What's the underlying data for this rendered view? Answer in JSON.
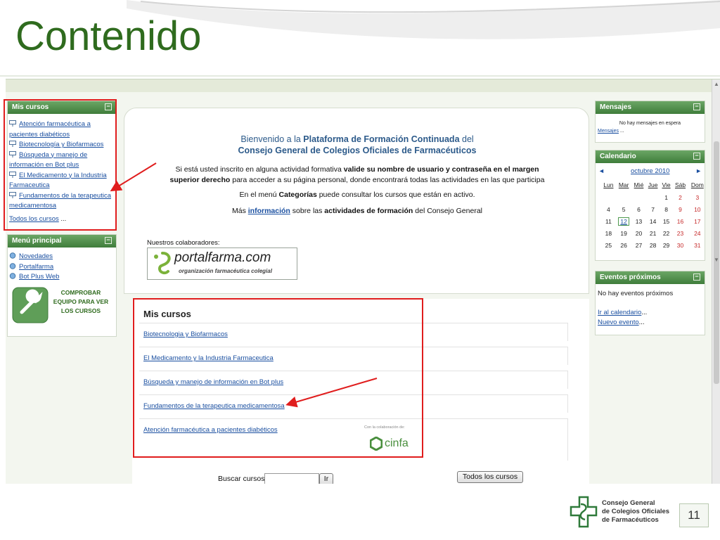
{
  "slide": {
    "title": "Contenido",
    "page_number": "11",
    "footer_logo": {
      "line1": "Consejo General",
      "line2": "de Colegios Oficiales",
      "line3": "de Farmacéuticos"
    }
  },
  "colors": {
    "brand_green": "#2f6b1e",
    "block_header": "#4f8f4a",
    "link_blue": "#1a4fa0",
    "highlight_red": "#e01d1d"
  },
  "left": {
    "mis_cursos": {
      "title": "Mis cursos",
      "courses": [
        {
          "label_1": "Atención farmacéutica a",
          "label_2": "pacientes diabéticos"
        },
        {
          "label_1": "Biotecnología y Biofarmacos",
          "label_2": ""
        },
        {
          "label_1": "Búsqueda y manejo de",
          "label_2": "información en Bot plus"
        },
        {
          "label_1": "El Medicamento y la Industria",
          "label_2": "Farmaceutica"
        },
        {
          "label_1": "Fundamentos de la terapeutica",
          "label_2": "medicamentosa"
        }
      ],
      "all_courses": "Todos los cursos",
      "all_courses_suffix": "..."
    },
    "menu_principal": {
      "title": "Menú principal",
      "items": [
        "Novedades",
        "Portalfarma",
        "Bot Plus Web"
      ],
      "check_button": {
        "line1": "COMPROBAR",
        "line2": "EQUIPO PARA VER",
        "line3": "LOS CURSOS"
      }
    }
  },
  "center": {
    "welcome_line1_pre": "Bienvenido a la ",
    "welcome_line1_bold": "Plataforma de Formación Continuada",
    "welcome_line1_post": " del",
    "welcome_line2": "Consejo General de Colegios Oficiales de Farmacéuticos",
    "para1_pre": "Si está usted inscrito en alguna actividad formativa ",
    "para1_bold1": "valide su nombre de usuario y contraseña en el margen",
    "para1_bold2": "superior derecho",
    "para1_post": " para acceder a su página personal, donde encontrará todas las actividades en las que participa",
    "para2_pre": "En el menú ",
    "para2_bold": "Categorías",
    "para2_post": " puede consultar los cursos que están en activo.",
    "para3_pre": "Más ",
    "para3_link": "información",
    "para3_mid": " sobre las ",
    "para3_bold": "actividades de formación",
    "para3_post": " del Consejo General",
    "collaborators_label": "Nuestros colaboradores:",
    "portalfarma_logo": {
      "main": "portalfarma.com",
      "sub": "organización farmacéutica colegial"
    }
  },
  "courses_panel": {
    "title": "Mis cursos",
    "courses": [
      "Biotecnologia y Biofarmacos",
      "El Medicamento y la Industria Farmaceutica",
      "Búsqueda y manejo de información en Bot plus",
      "Fundamentos de la terapeutica medicamentosa",
      "Atención farmacéutica a pacientes diabéticos"
    ],
    "sponsor_note": "Con la colaboración de:",
    "sponsor_logo": "cinfa"
  },
  "search": {
    "label": "Buscar cursos:",
    "value": "",
    "go_button": "Ir",
    "all_courses_button": "Todos los cursos"
  },
  "right": {
    "mensajes": {
      "title": "Mensajes",
      "empty": "No hay mensajes en espera",
      "link": "Mensajes",
      "link_suffix": "..."
    },
    "calendario": {
      "title": "Calendario",
      "prev": "◄",
      "next": "►",
      "month": "octubre 2010",
      "weekdays": [
        "Lun",
        "Mar",
        "Mié",
        "Jue",
        "Vie",
        "Sáb",
        "Dom"
      ],
      "weeks": [
        [
          "",
          "",
          "",
          "",
          "1",
          "2",
          "3"
        ],
        [
          "4",
          "5",
          "6",
          "7",
          "8",
          "9",
          "10"
        ],
        [
          "11",
          "12",
          "13",
          "14",
          "15",
          "16",
          "17"
        ],
        [
          "18",
          "19",
          "20",
          "21",
          "22",
          "23",
          "24"
        ],
        [
          "25",
          "26",
          "27",
          "28",
          "29",
          "30",
          "31"
        ]
      ],
      "today": "12"
    },
    "eventos": {
      "title": "Eventos próximos",
      "empty": "No hay eventos próximos",
      "link1": "Ir al calendario",
      "link2": "Nuevo evento",
      "suffix": "..."
    }
  }
}
